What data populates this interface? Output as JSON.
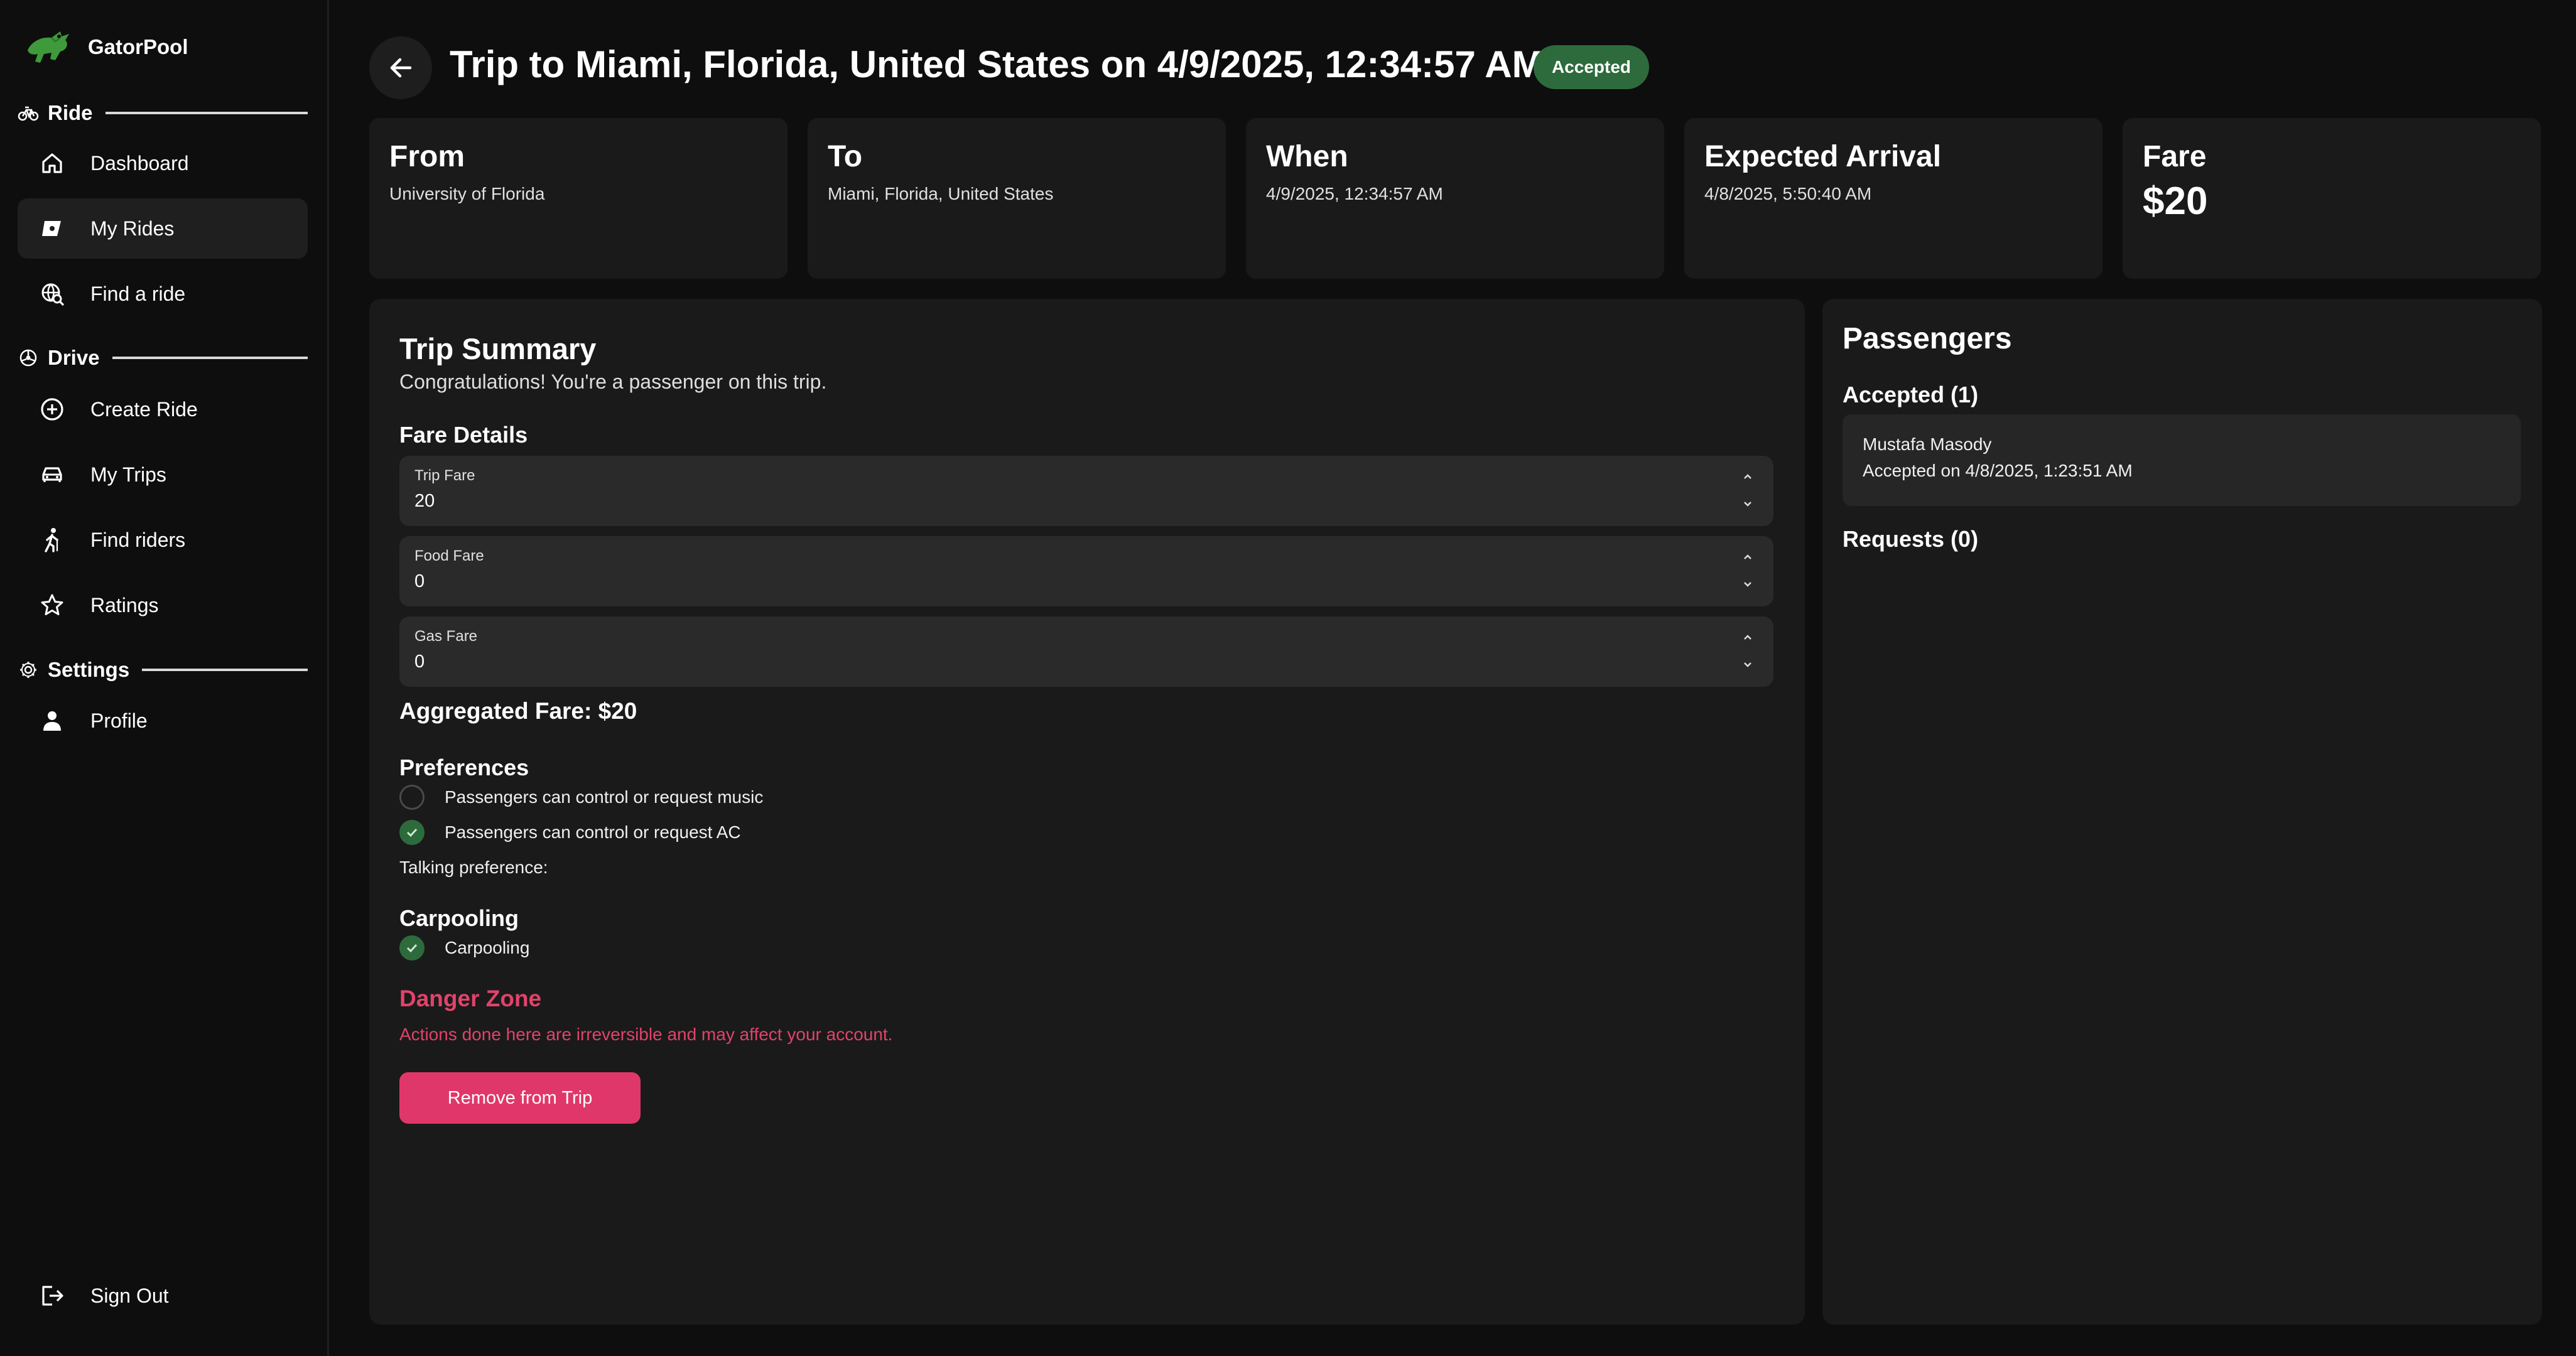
{
  "app": {
    "name": "GatorPool"
  },
  "sidebar": {
    "sections": [
      {
        "title": "Ride",
        "icon": "bike-icon"
      },
      {
        "title": "Drive",
        "icon": "steering-wheel-icon"
      },
      {
        "title": "Settings",
        "icon": "gear-icon"
      }
    ],
    "items": [
      {
        "label": "Dashboard",
        "icon": "home-icon"
      },
      {
        "label": "My Rides",
        "icon": "ticket-icon"
      },
      {
        "label": "Find a ride",
        "icon": "globe-search-icon"
      },
      {
        "label": "Create Ride",
        "icon": "plus-circle-icon"
      },
      {
        "label": "My Trips",
        "icon": "car-icon"
      },
      {
        "label": "Find riders",
        "icon": "person-walking-icon"
      },
      {
        "label": "Ratings",
        "icon": "star-icon"
      },
      {
        "label": "Profile",
        "icon": "person-icon"
      }
    ],
    "sign_out": "Sign Out"
  },
  "header": {
    "title": "Trip to Miami, Florida, United States on 4/9/2025, 12:34:57 AM",
    "status": "Accepted"
  },
  "cards": [
    {
      "title": "From",
      "value": "University of Florida"
    },
    {
      "title": "To",
      "value": "Miami, Florida, United States"
    },
    {
      "title": "When",
      "value": "4/9/2025, 12:34:57 AM"
    },
    {
      "title": "Expected Arrival",
      "value": "4/8/2025, 5:50:40 AM"
    },
    {
      "title": "Fare",
      "value": "$20"
    }
  ],
  "summary": {
    "title": "Trip Summary",
    "subtitle": "Congratulations! You're a passenger on this trip.",
    "fare_details_heading": "Fare Details",
    "fares": [
      {
        "label": "Trip Fare",
        "value": "20"
      },
      {
        "label": "Food Fare",
        "value": "0"
      },
      {
        "label": "Gas Fare",
        "value": "0"
      }
    ],
    "aggregated": "Aggregated Fare: $20",
    "preferences_heading": "Preferences",
    "preferences": [
      {
        "label": "Passengers can control or request music",
        "checked": false
      },
      {
        "label": "Passengers can control or request AC",
        "checked": true
      }
    ],
    "talking": "Talking preference:",
    "carpooling_heading": "Carpooling",
    "carpooling": {
      "label": "Carpooling",
      "checked": true
    },
    "danger_title": "Danger Zone",
    "danger_sub": "Actions done here are irreversible and may affect your account.",
    "danger_button": "Remove from Trip"
  },
  "passengers": {
    "title": "Passengers",
    "accepted_heading": "Accepted (1)",
    "accepted": [
      {
        "name": "Mustafa Masody",
        "meta": "Accepted on 4/8/2025, 1:23:51 AM"
      }
    ],
    "requests_heading": "Requests (0)"
  },
  "colors": {
    "accent_green": "#2e6b3c",
    "danger": "#e0436a",
    "background": "#0e0e0e",
    "panel": "#1a1a1a"
  }
}
